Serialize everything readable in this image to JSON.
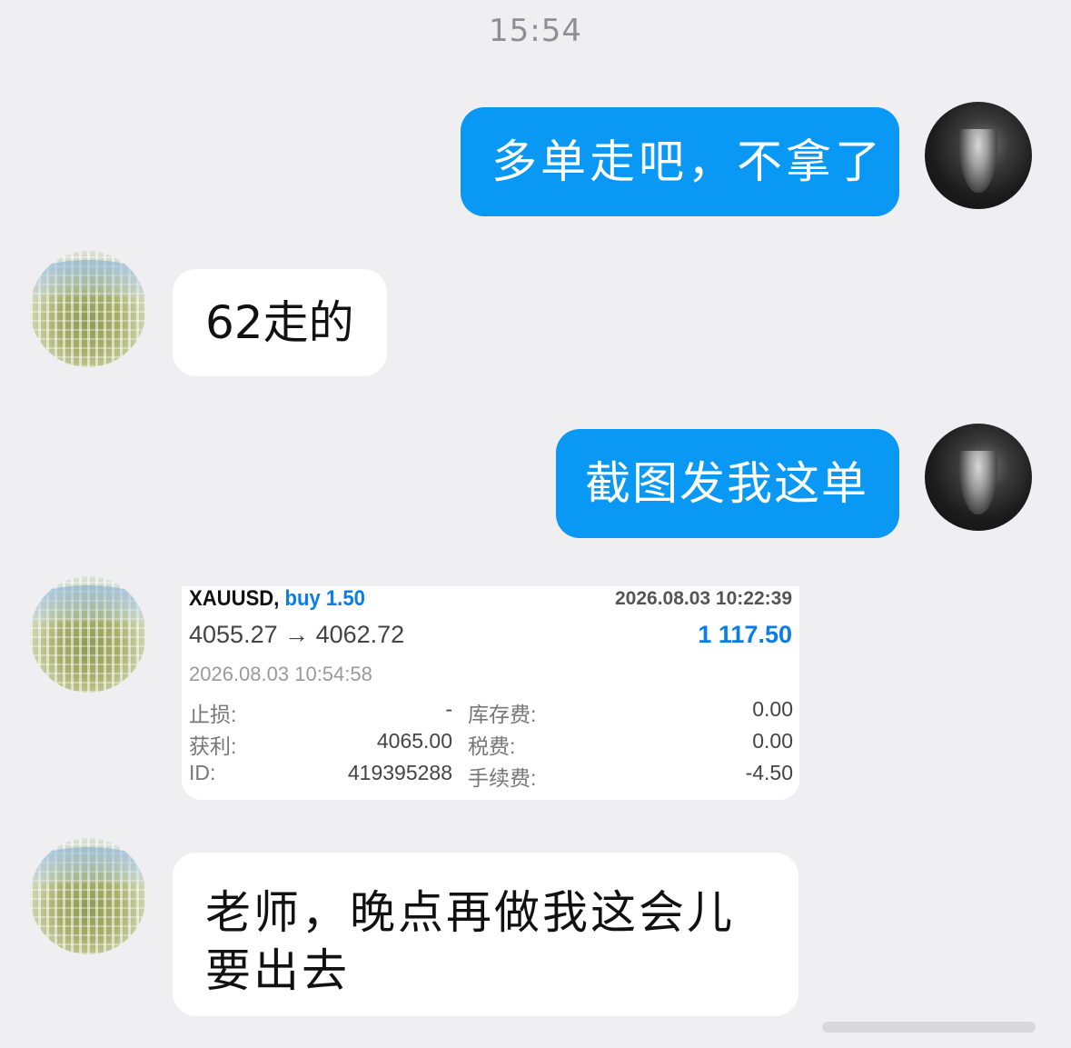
{
  "status_time": "15:54",
  "messages": [
    {
      "sender": "me",
      "text": "多单走吧，不拿了"
    },
    {
      "sender": "other",
      "text": "62走的"
    },
    {
      "sender": "me",
      "text": "截图发我这单"
    },
    {
      "sender": "other",
      "type": "trade_card"
    },
    {
      "sender": "other",
      "text": "老师，晚点再做我这会儿要出去"
    }
  ],
  "trade": {
    "symbol": "XAUUSD,",
    "direction": "buy 1.50",
    "open_time": "2026.08.03 10:22:39",
    "prices": "4055.27 → 4062.72",
    "profit": "1 117.50",
    "close_time": "2026.08.03 10:54:58",
    "rows": [
      {
        "label_left": "止损:",
        "value_left": "-",
        "label_right": "库存费:",
        "value_right": "0.00"
      },
      {
        "label_left": "获利:",
        "value_left": "4065.00",
        "label_right": "税费:",
        "value_right": "0.00"
      },
      {
        "label_left": "ID:",
        "value_left": "419395288",
        "label_right": "手续费:",
        "value_right": "-4.50"
      }
    ]
  },
  "colors": {
    "outgoing_bubble": "#0a98f5",
    "incoming_bubble": "#ffffff",
    "background": "#efeff1",
    "accent_blue": "#0a7ee6"
  }
}
